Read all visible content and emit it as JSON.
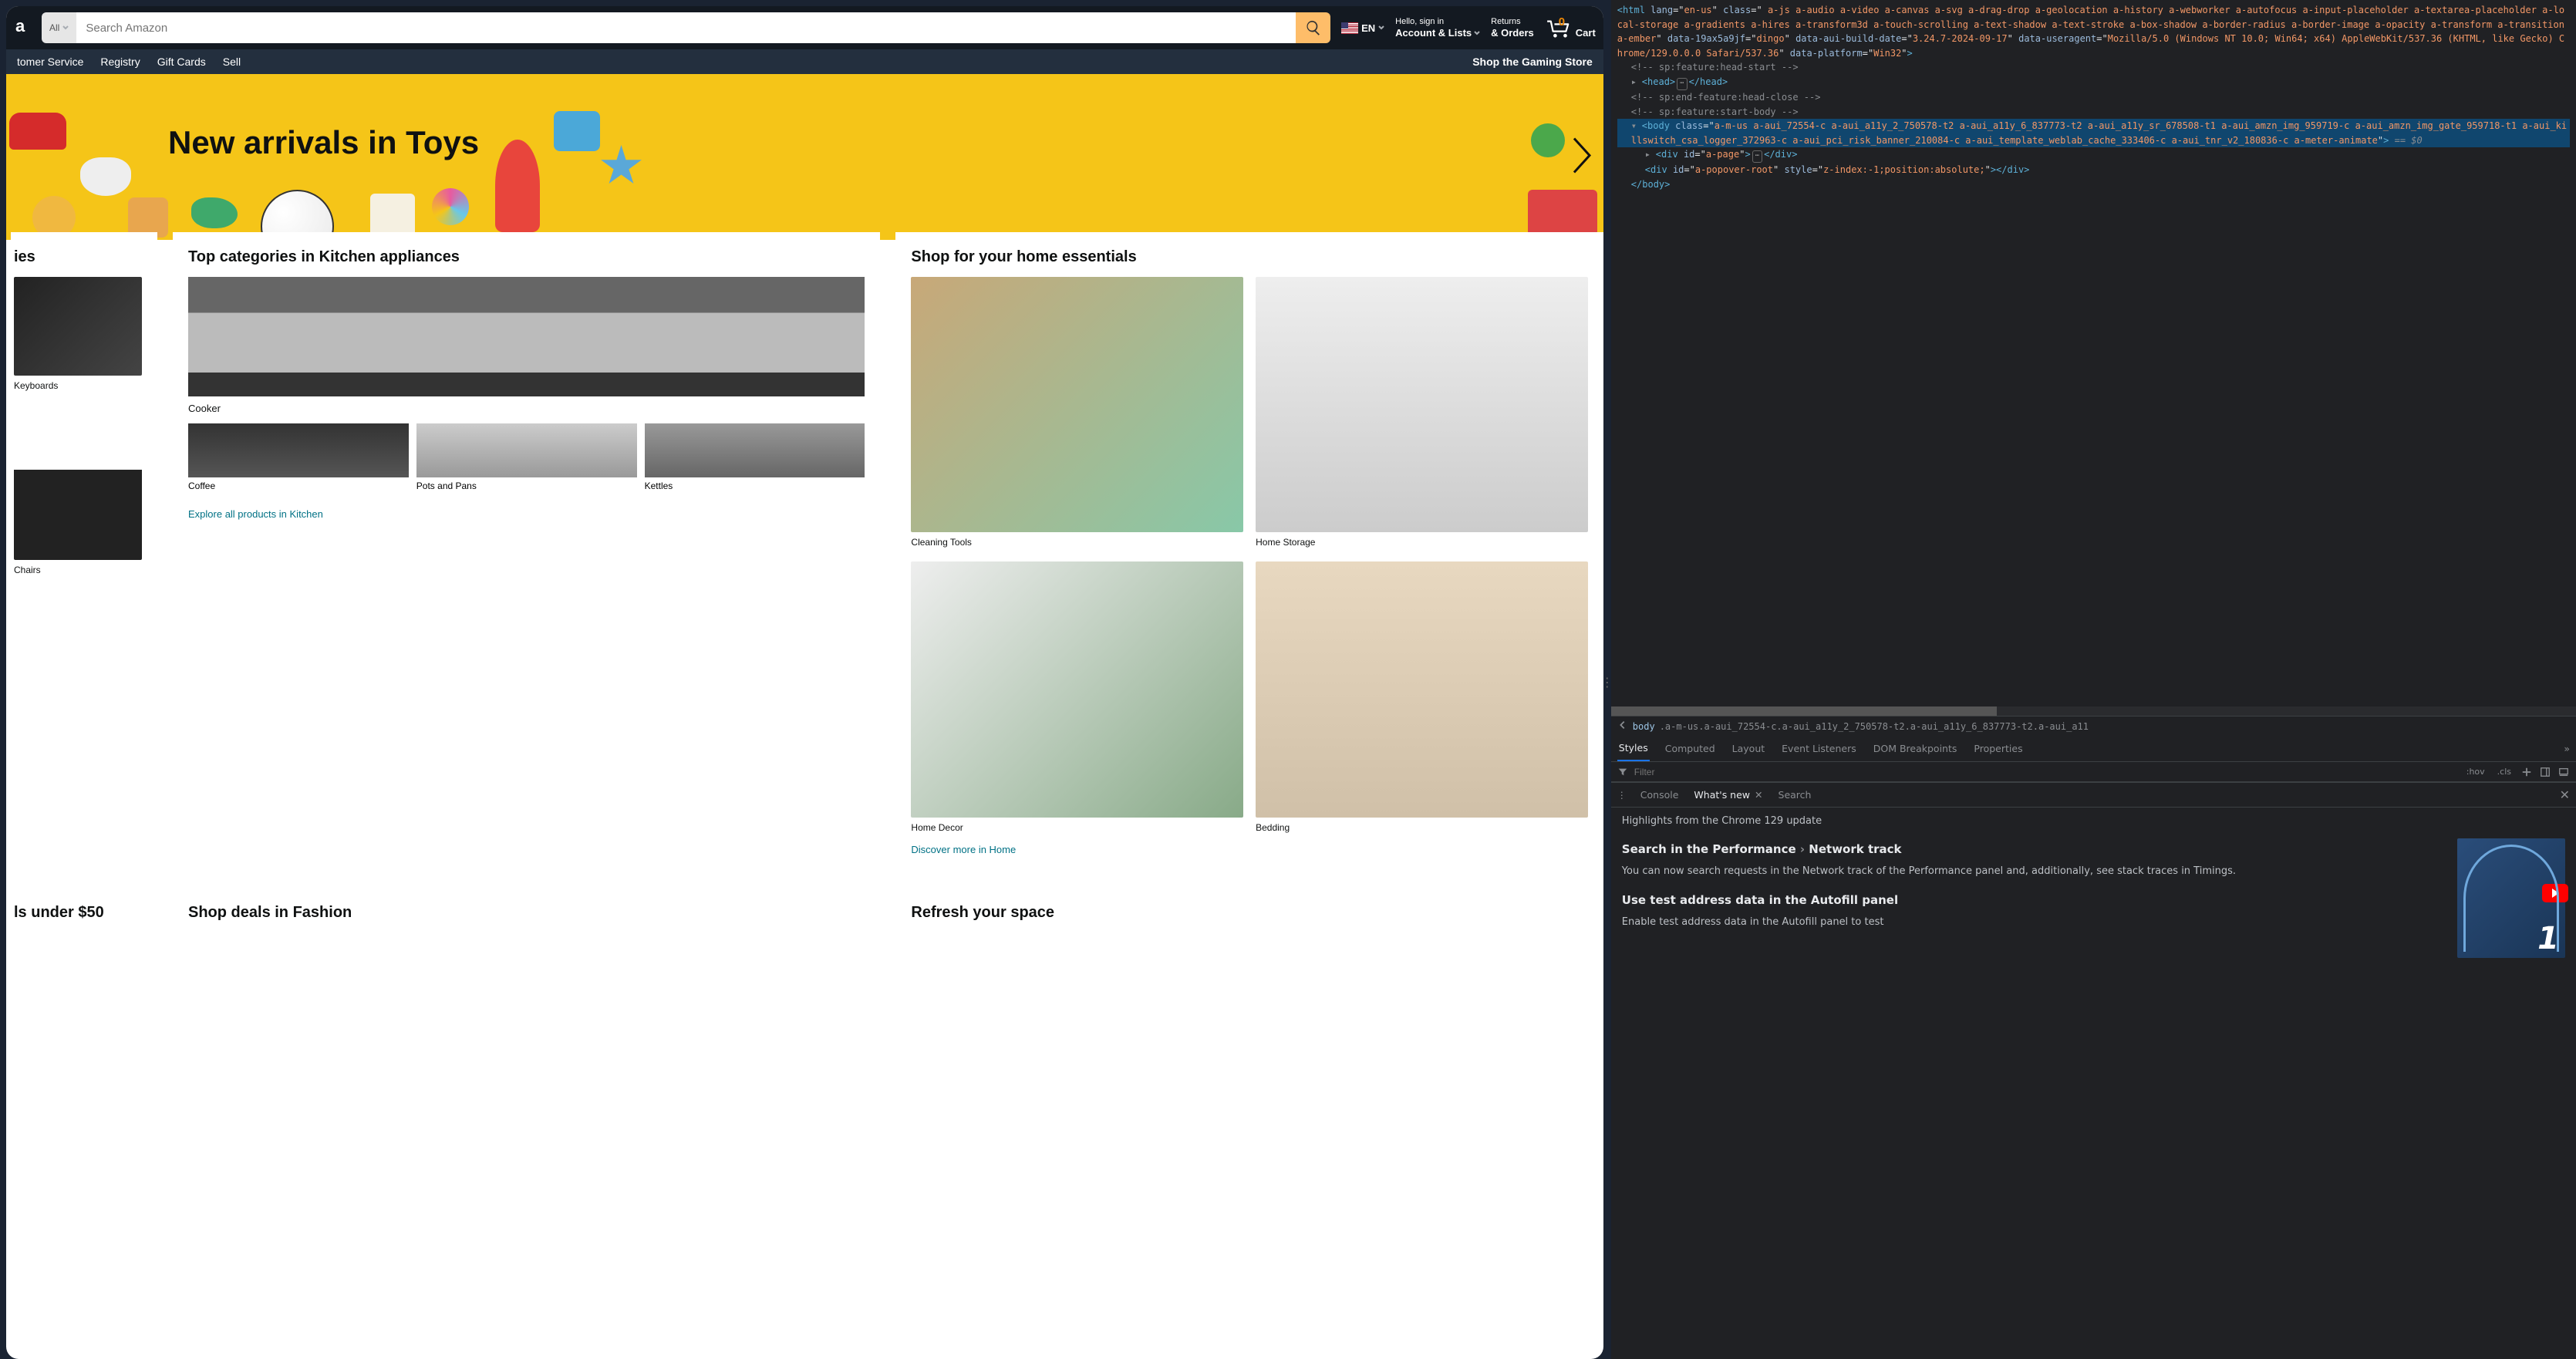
{
  "amazon": {
    "search": {
      "category": "All",
      "placeholder": "Search Amazon"
    },
    "lang": "EN",
    "account": {
      "topline": "Hello, sign in",
      "bottomline": "Account & Lists"
    },
    "returns": {
      "topline": "Returns",
      "bottomline": "& Orders"
    },
    "cart": {
      "count": "0",
      "label": "Cart"
    },
    "subnav": {
      "items": [
        "tomer Service",
        "Registry",
        "Gift Cards",
        "Sell"
      ],
      "promo": "Shop the Gaming Store"
    },
    "hero": {
      "headline": "New arrivals in Toys"
    },
    "cards": {
      "gaming": {
        "title": "ies",
        "items": [
          {
            "label": "Keyboards"
          },
          {
            "label": "Chairs"
          }
        ]
      },
      "kitchen": {
        "title": "Top categories in Kitchen appliances",
        "main_label": "Cooker",
        "row": [
          {
            "label": "Coffee"
          },
          {
            "label": "Pots and Pans"
          },
          {
            "label": "Kettles"
          }
        ],
        "link": "Explore all products in Kitchen"
      },
      "home": {
        "title": "Shop for your home essentials",
        "grid": [
          {
            "label": "Cleaning Tools"
          },
          {
            "label": "Home Storage"
          },
          {
            "label": "Home Decor"
          },
          {
            "label": "Bedding"
          }
        ],
        "link": "Discover more in Home"
      },
      "row2": {
        "deals": "ls under $50",
        "fashion": "Shop deals in Fashion",
        "refresh": "Refresh your space"
      }
    }
  },
  "devtools": {
    "html": {
      "lang": "en-us",
      "class": " a-js a-audio a-video a-canvas a-svg a-drag-drop a-geolocation a-history a-webworker a-autofocus a-input-placeholder a-textarea-placeholder a-local-storage a-gradients a-hires a-transform3d a-touch-scrolling a-text-shadow a-text-stroke a-box-shadow a-border-radius a-border-image a-opacity a-transform a-transition a-ember",
      "aui_attr": "data-19ax5a9jf",
      "aui_val": "dingo",
      "build_attr": "data-aui-build-date",
      "build_val": "3.24.7-2024-09-17",
      "ua_attr": "data-useragent",
      "ua_val": "Mozilla/5.0 (Windows NT 10.0; Win64; x64) AppleWebKit/537.36 (KHTML, like Gecko) Chrome/129.0.0.0 Safari/537.36",
      "platform_attr": "data-platform",
      "platform_val": "Win32"
    },
    "comments": {
      "c1": " sp:feature:head-start ",
      "c2": " sp:end-feature:head-close ",
      "c3": " sp:feature:start-body "
    },
    "body_class": "a-m-us a-aui_72554-c a-aui_a11y_2_750578-t2 a-aui_a11y_6_837773-t2 a-aui_a11y_sr_678508-t1 a-aui_amzn_img_959719-c a-aui_amzn_img_gate_959718-t1 a-aui_killswitch_csa_logger_372963-c a-aui_pci_risk_banner_210084-c a-aui_template_weblab_cache_333406-c a-aui_tnr_v2_180836-c a-meter-animate",
    "body_pseudo": " == $0",
    "apage_id": "a-page",
    "popover": {
      "id": "a-popover-root",
      "style": "z-index:-1;position:absolute;"
    },
    "crumb": {
      "sel": "body",
      "rest": ".a-m-us.a-aui_72554-c.a-aui_a11y_2_750578-t2.a-aui_a11y_6_837773-t2.a-aui_a11"
    },
    "styles_tabs": [
      "Styles",
      "Computed",
      "Layout",
      "Event Listeners",
      "DOM Breakpoints",
      "Properties"
    ],
    "filter_placeholder": "Filter",
    "filter_btns": {
      "hov": ":hov",
      "cls": ".cls"
    },
    "drawer": {
      "tabs": [
        "Console",
        "What's new",
        "Search"
      ],
      "subtitle": "Highlights from the Chrome 129 update",
      "h1a": "Search in the Performance ",
      "h1b": " Network track",
      "p1": "You can now search requests in the Network track of the Performance panel and, additionally, see stack traces in Timings.",
      "h2": "Use test address data in the Autofill panel",
      "p2": "Enable test address data in the Autofill panel to test"
    }
  }
}
